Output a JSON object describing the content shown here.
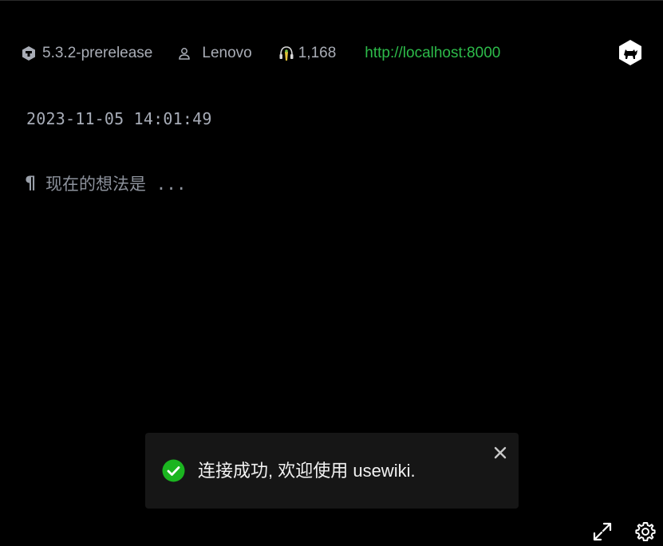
{
  "header": {
    "version": "5.3.2-prerelease",
    "version_icon": "cube-logo-icon",
    "user": "Lenovo",
    "user_icon": "user-icon",
    "count": "1,168",
    "count_icon": "headset-icon",
    "url": "http://localhost:8000",
    "logo_icon": "tiddlywiki-cat-logo-icon"
  },
  "main": {
    "timestamp": "2023-11-05 14:01:49",
    "prompt_icon": "pilcrow-icon",
    "prompt_placeholder": "现在的想法是 ..."
  },
  "toast": {
    "message": "连接成功, 欢迎使用 usewiki.",
    "status_icon": "check-circle-icon",
    "close_icon": "close-icon"
  },
  "footer": {
    "expand_icon": "expand-icon",
    "settings_icon": "gear-icon"
  },
  "colors": {
    "background": "#000000",
    "url": "#2dbb4a",
    "success": "#1bb520",
    "toast_bg": "#161616",
    "text_muted": "#a9adb6"
  }
}
